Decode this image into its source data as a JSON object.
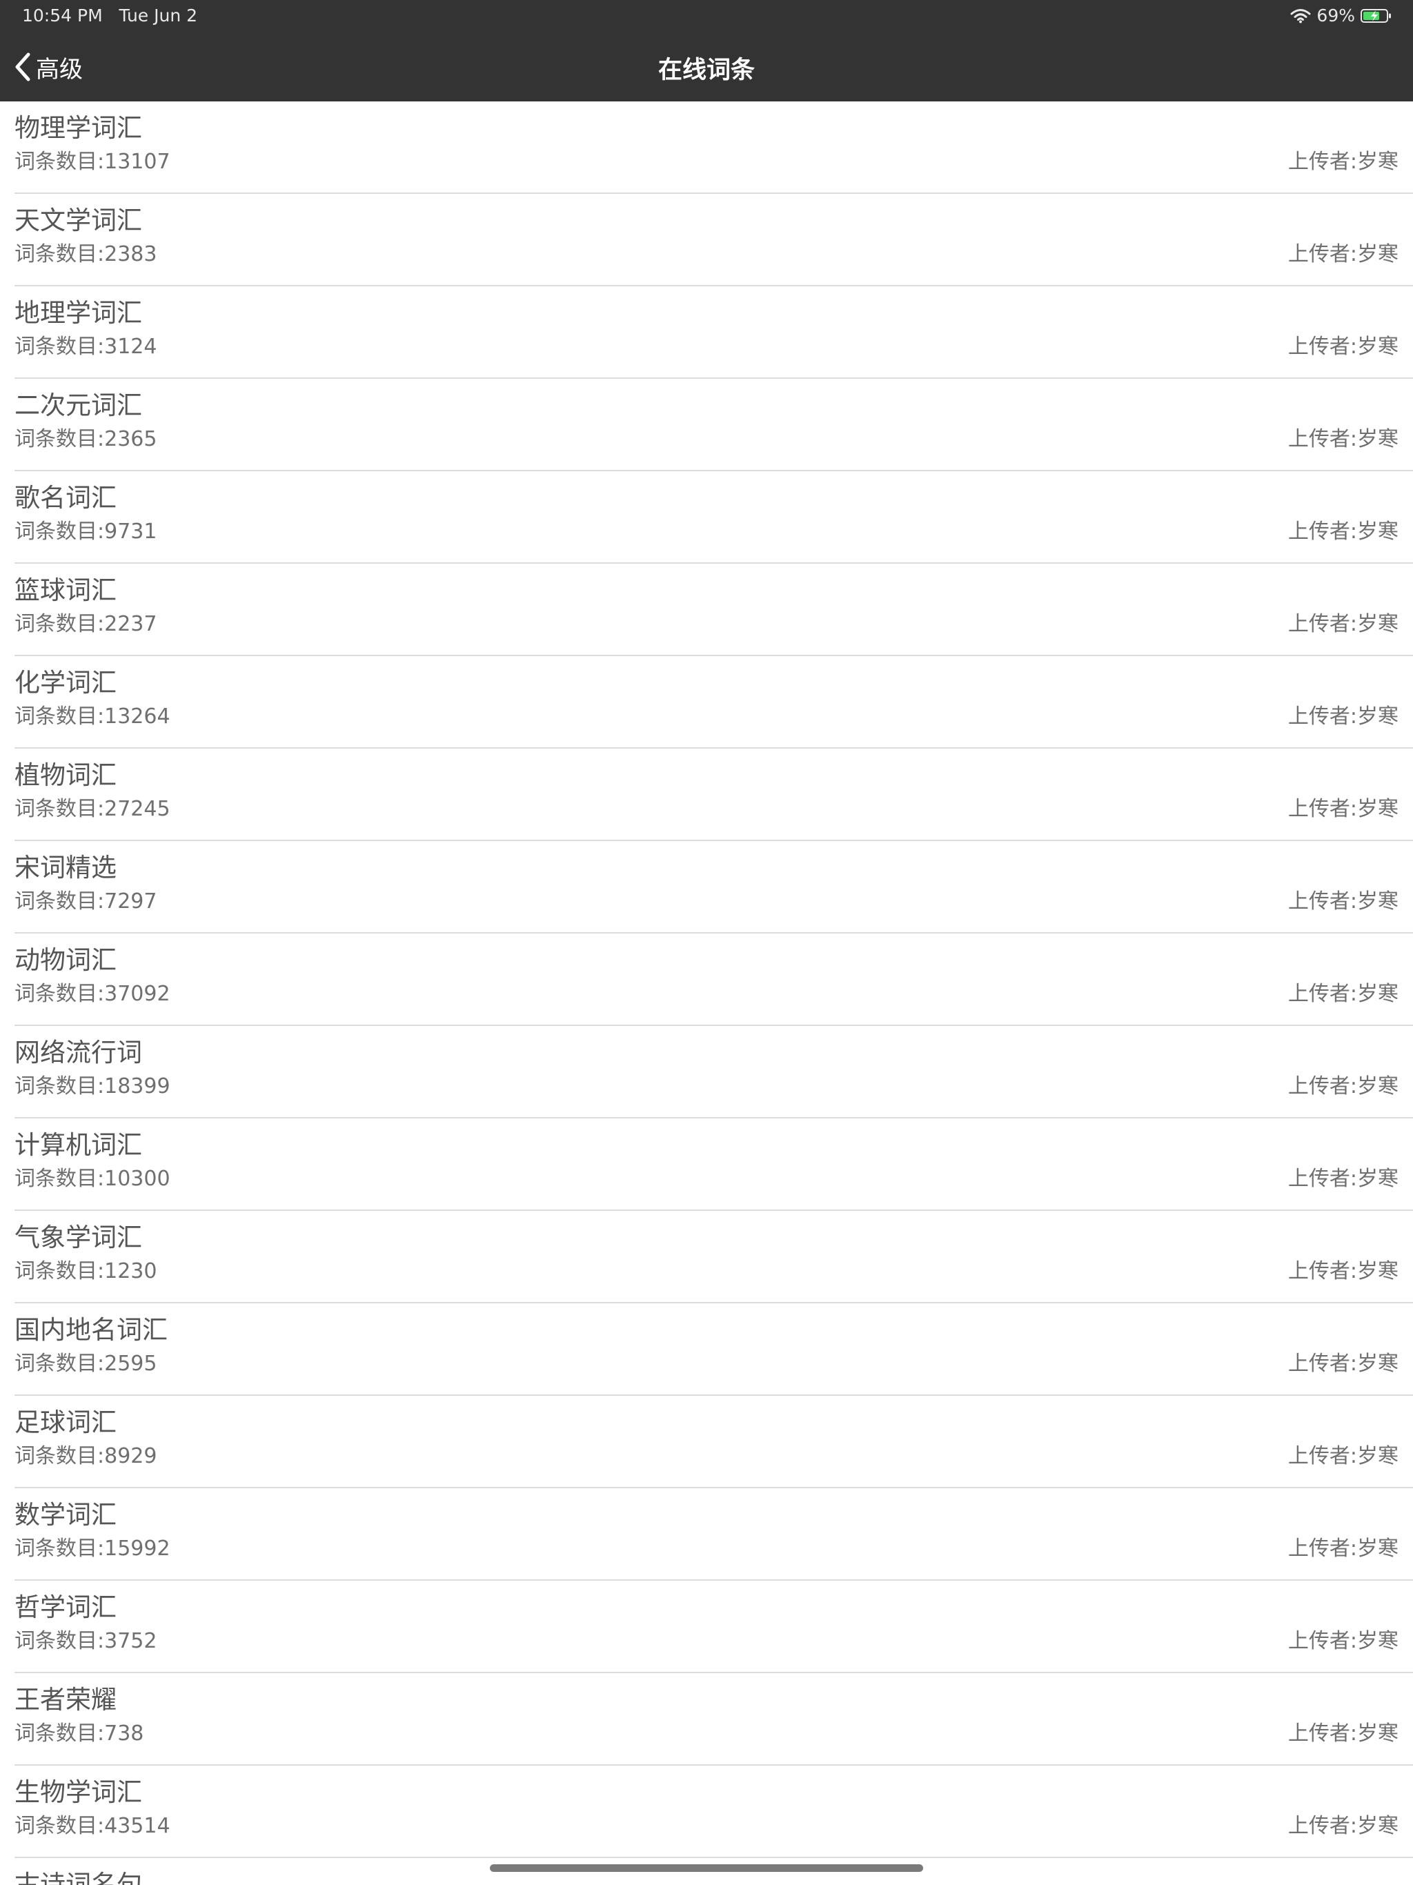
{
  "status_bar": {
    "time": "10:54 PM",
    "date": "Tue Jun 2",
    "battery": "69%",
    "wifi_icon": "wifi-icon",
    "battery_icon": "battery-charging-icon"
  },
  "nav": {
    "back_label": "高级",
    "back_icon": "chevron-left-icon",
    "title": "在线词条"
  },
  "items": [
    {
      "title": "物理学词汇",
      "count": "词条数目:13107",
      "uploader": "上传者:岁寒"
    },
    {
      "title": "天文学词汇",
      "count": "词条数目:2383",
      "uploader": "上传者:岁寒"
    },
    {
      "title": "地理学词汇",
      "count": "词条数目:3124",
      "uploader": "上传者:岁寒"
    },
    {
      "title": "二次元词汇",
      "count": "词条数目:2365",
      "uploader": "上传者:岁寒"
    },
    {
      "title": "歌名词汇",
      "count": "词条数目:9731",
      "uploader": "上传者:岁寒"
    },
    {
      "title": "篮球词汇",
      "count": "词条数目:2237",
      "uploader": "上传者:岁寒"
    },
    {
      "title": "化学词汇",
      "count": "词条数目:13264",
      "uploader": "上传者:岁寒"
    },
    {
      "title": "植物词汇",
      "count": "词条数目:27245",
      "uploader": "上传者:岁寒"
    },
    {
      "title": "宋词精选",
      "count": "词条数目:7297",
      "uploader": "上传者:岁寒"
    },
    {
      "title": "动物词汇",
      "count": "词条数目:37092",
      "uploader": "上传者:岁寒"
    },
    {
      "title": "网络流行词",
      "count": "词条数目:18399",
      "uploader": "上传者:岁寒"
    },
    {
      "title": "计算机词汇",
      "count": "词条数目:10300",
      "uploader": "上传者:岁寒"
    },
    {
      "title": "气象学词汇",
      "count": "词条数目:1230",
      "uploader": "上传者:岁寒"
    },
    {
      "title": "国内地名词汇",
      "count": "词条数目:2595",
      "uploader": "上传者:岁寒"
    },
    {
      "title": "足球词汇",
      "count": "词条数目:8929",
      "uploader": "上传者:岁寒"
    },
    {
      "title": "数学词汇",
      "count": "词条数目:15992",
      "uploader": "上传者:岁寒"
    },
    {
      "title": "哲学词汇",
      "count": "词条数目:3752",
      "uploader": "上传者:岁寒"
    },
    {
      "title": "王者荣耀",
      "count": "词条数目:738",
      "uploader": "上传者:岁寒"
    },
    {
      "title": "生物学词汇",
      "count": "词条数目:43514",
      "uploader": "上传者:岁寒"
    },
    {
      "title": "古诗词名句",
      "count": "",
      "uploader": ""
    }
  ],
  "colors": {
    "nav_background": "#333333",
    "text_primary": "#555555",
    "text_secondary": "#6f6f6f",
    "separator": "#dddddd",
    "battery_fill": "#4cd964"
  }
}
